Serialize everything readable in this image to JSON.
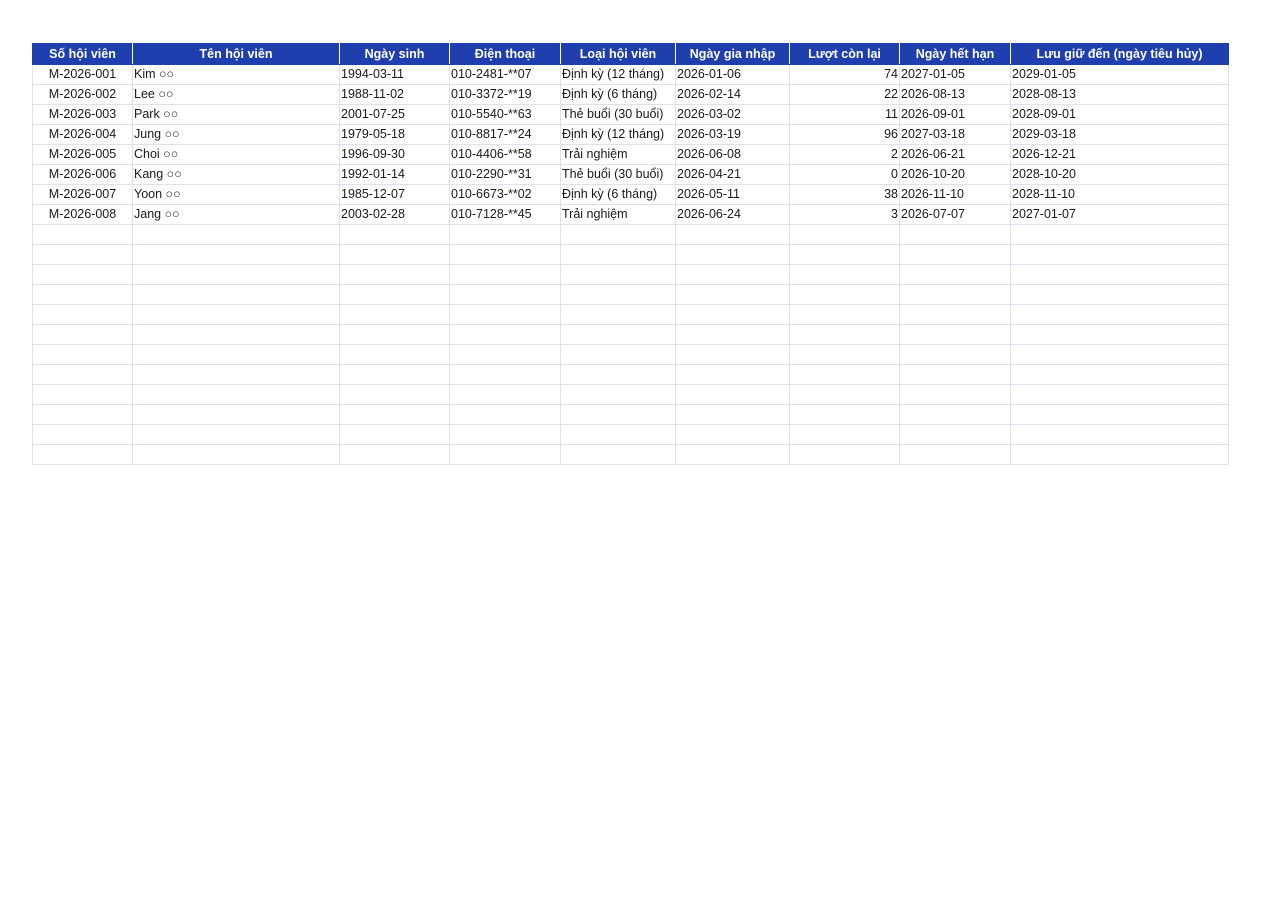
{
  "columns": [
    "Số hội viên",
    "Tên hội viên",
    "Ngày sinh",
    "Điện thoại",
    "Loại hội viên",
    "Ngày gia nhập",
    "Lượt còn lại",
    "Ngày hết hạn",
    "Lưu giữ đến (ngày tiêu hủy)"
  ],
  "rows": [
    {
      "id": "M-2026-001",
      "name": "Kim ○○",
      "dob": "1994-03-11",
      "phone": "010-2481-**07",
      "type": "Định kỳ (12 tháng)",
      "joined": "2026-01-06",
      "remaining": "74",
      "expires": "2027-01-05",
      "retain_until": "2029-01-05"
    },
    {
      "id": "M-2026-002",
      "name": "Lee ○○",
      "dob": "1988-11-02",
      "phone": "010-3372-**19",
      "type": "Định kỳ (6 tháng)",
      "joined": "2026-02-14",
      "remaining": "22",
      "expires": "2026-08-13",
      "retain_until": "2028-08-13"
    },
    {
      "id": "M-2026-003",
      "name": "Park ○○",
      "dob": "2001-07-25",
      "phone": "010-5540-**63",
      "type": "Thẻ buổi (30 buổi)",
      "joined": "2026-03-02",
      "remaining": "11",
      "expires": "2026-09-01",
      "retain_until": "2028-09-01"
    },
    {
      "id": "M-2026-004",
      "name": "Jung ○○",
      "dob": "1979-05-18",
      "phone": "010-8817-**24",
      "type": "Định kỳ (12 tháng)",
      "joined": "2026-03-19",
      "remaining": "96",
      "expires": "2027-03-18",
      "retain_until": "2029-03-18"
    },
    {
      "id": "M-2026-005",
      "name": "Choi ○○",
      "dob": "1996-09-30",
      "phone": "010-4406-**58",
      "type": "Trải nghiệm",
      "joined": "2026-06-08",
      "remaining": "2",
      "expires": "2026-06-21",
      "retain_until": "2026-12-21"
    },
    {
      "id": "M-2026-006",
      "name": "Kang ○○",
      "dob": "1992-01-14",
      "phone": "010-2290-**31",
      "type": "Thẻ buổi (30 buổi)",
      "joined": "2026-04-21",
      "remaining": "0",
      "expires": "2026-10-20",
      "retain_until": "2028-10-20"
    },
    {
      "id": "M-2026-007",
      "name": "Yoon ○○",
      "dob": "1985-12-07",
      "phone": "010-6673-**02",
      "type": "Định kỳ (6 tháng)",
      "joined": "2026-05-11",
      "remaining": "38",
      "expires": "2026-11-10",
      "retain_until": "2028-11-10"
    },
    {
      "id": "M-2026-008",
      "name": "Jang ○○",
      "dob": "2003-02-28",
      "phone": "010-7128-**45",
      "type": "Trải nghiệm",
      "joined": "2026-06-24",
      "remaining": "3",
      "expires": "2026-07-07",
      "retain_until": "2027-01-07"
    }
  ],
  "colors": {
    "header_bg": "#1f3fae",
    "header_text": "#ffffff",
    "grid_line": "#dde3ee"
  }
}
